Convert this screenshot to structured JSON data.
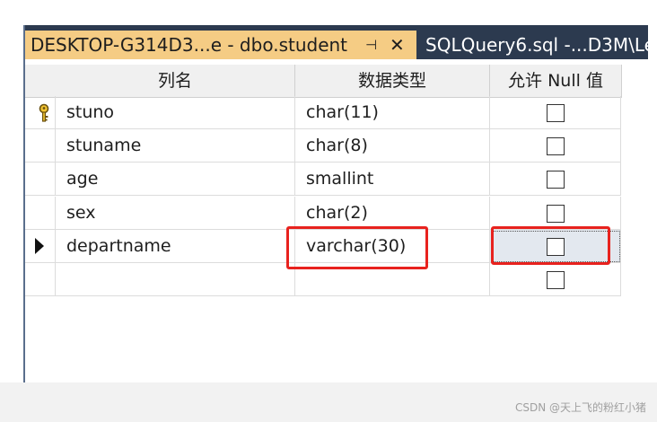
{
  "tabs": {
    "active_title": "DESKTOP-G314D3...e - dbo.student",
    "active_pin": "⊣",
    "active_close": "✕",
    "inactive_title": "SQLQuery6.sql -...D3M\\Le"
  },
  "grid": {
    "headers": [
      "列名",
      "数据类型",
      "允许 Null 值"
    ],
    "rows": [
      {
        "name": "stuno",
        "type": "char(11)",
        "allow_null": false,
        "key": true
      },
      {
        "name": "stuname",
        "type": "char(8)",
        "allow_null": false
      },
      {
        "name": "age",
        "type": "smallint",
        "allow_null": false
      },
      {
        "name": "sex",
        "type": "char(2)",
        "allow_null": false
      },
      {
        "name": "departname",
        "type": "varchar(30)",
        "allow_null": false,
        "current": true
      },
      {
        "name": "",
        "type": "",
        "allow_null": false
      }
    ]
  },
  "watermark": "CSDN @天上飞的粉红小猪",
  "colors": {
    "tab_active": "#f5cc84",
    "tabbar": "#2c3a4f",
    "highlight": "#e8221e"
  }
}
